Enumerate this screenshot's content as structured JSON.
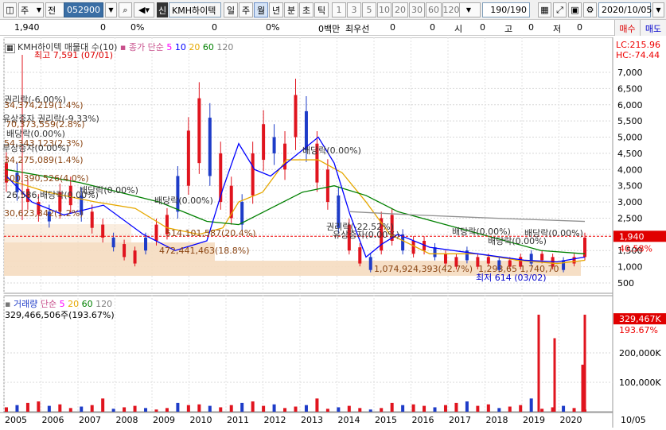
{
  "toolbar": {
    "period_opt": "주",
    "prev_opt": "전",
    "code": "052900",
    "stock_tag": "신",
    "stock_name": "KMH하이텍",
    "period_tabs": [
      "일",
      "주",
      "월",
      "년",
      "분",
      "초",
      "틱"
    ],
    "active_period": "월",
    "interval_btns": [
      "1",
      "3",
      "5",
      "10",
      "20",
      "30",
      "60",
      "120"
    ],
    "count": "190/190",
    "date": "2020/10/05"
  },
  "quote": {
    "price": "1,940",
    "v1": "0",
    "v1p": "0%",
    "v2": "0",
    "v2p": "0%",
    "money": "0백만",
    "best_label": "최우선",
    "best": "0",
    "v3": "0",
    "open_label": "시",
    "open": "0",
    "high_label": "고",
    "high": "0",
    "low_label": "저",
    "low": "0",
    "buy": "매수",
    "sell": "매도"
  },
  "price_panel": {
    "title": "KMH하이텍 매물대 수(10)",
    "ma_title": "종가 단순",
    "ma_list": [
      {
        "label": "5",
        "color": "#ff00ff"
      },
      {
        "label": "10",
        "color": "#0000ff"
      },
      {
        "label": "20",
        "color": "#e6a800"
      },
      {
        "label": "60",
        "color": "#008000"
      },
      {
        "label": "120",
        "color": "#808080"
      }
    ],
    "lc": "LC:215.96",
    "hc": "HC:-74.44",
    "high_note": "최고 7,591 (07/01)",
    "low_note": "최저 614 (03/02)",
    "current_price": "1,940",
    "current_pct": "40.58%",
    "y_labels": [
      "7,000",
      "6,500",
      "6,000",
      "5,500",
      "5,000",
      "4,500",
      "4,000",
      "3,500",
      "3,000",
      "2,500",
      "2,000",
      "1,500",
      "1,000",
      "500"
    ],
    "annotations": [
      {
        "text": "권리락(-6.00%)",
        "color": "#333"
      },
      {
        "text": "34,374,219(1.4%)",
        "color": "#8b4513"
      },
      {
        "text": "유상증자 권리락(-9.33%)",
        "color": "#333"
      },
      {
        "text": "70,373,559(2.8%)",
        "color": "#8b4513"
      },
      {
        "text": "배당락(0.00%)",
        "color": "#333"
      },
      {
        "text": "54,343,123(2.3%)",
        "color": "#8b4513"
      },
      {
        "text": "무상증자(0.00%)",
        "color": "#333"
      },
      {
        "text": "34,275,089(1.4%)",
        "color": "#8b4513"
      },
      {
        "text": "100,390,526(4.0%)",
        "color": "#8b4513"
      },
      {
        "text": "26,586,배당락(0.00%)",
        "color": "#333"
      },
      {
        "text": "배당락(0.00%)",
        "color": "#333"
      },
      {
        "text": "30,623,342(1.2%)",
        "color": "#8b4513"
      },
      {
        "text": "배당락(0.00%)",
        "color": "#333"
      },
      {
        "text": "514,101,587(20.4%)",
        "color": "#8b4513"
      },
      {
        "text": "472,441,463(18.8%)",
        "color": "#8b4513"
      },
      {
        "text": "배당락(0.00%)",
        "color": "#333"
      },
      {
        "text": "권리락(-22.52%)",
        "color": "#333"
      },
      {
        "text": "유상증자(0.00%)",
        "color": "#333"
      },
      {
        "text": "1,074,924,393(42.7%)",
        "color": "#8b4513"
      },
      {
        "text": "1,293,65 1,740,70",
        "color": "#8b4513"
      },
      {
        "text": "배당락(0.00%)",
        "color": "#333"
      },
      {
        "text": "배당락(0.00%)",
        "color": "#333"
      },
      {
        "text": "배당락(0.00%)",
        "color": "#333"
      }
    ]
  },
  "volume_panel": {
    "title": "거래량",
    "ma_title": "단순",
    "ma_list": [
      {
        "label": "5",
        "color": "#ff00ff"
      },
      {
        "label": "20",
        "color": "#e6a800"
      },
      {
        "label": "60",
        "color": "#008000"
      },
      {
        "label": "120",
        "color": "#808080"
      }
    ],
    "current_vol": "329,466,506주(193.67%)",
    "tag_value": "329,467K",
    "tag_pct": "193.67%",
    "y_labels": [
      "200,000K",
      "100,000K"
    ]
  },
  "x_axis": {
    "years": [
      "2005",
      "2006",
      "2007",
      "2008",
      "2009",
      "2010",
      "2011",
      "2012",
      "2013",
      "2014",
      "2015",
      "2016",
      "2017",
      "2018",
      "2019",
      "2020"
    ],
    "last": "10/05"
  },
  "colors": {
    "up": "#e0141e",
    "down": "#1e3cc8",
    "band": "#f5dcc0"
  }
}
